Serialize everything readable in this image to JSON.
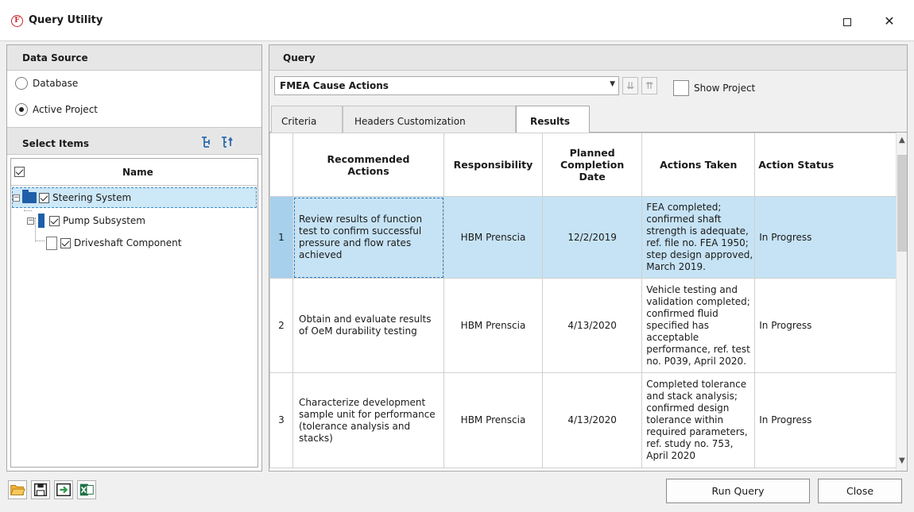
{
  "window": {
    "title": "Query Utility",
    "logo_letter": "F",
    "maximize_icon": "maximize-icon",
    "close_glyph": "✕"
  },
  "data_source": {
    "header": "Data Source",
    "options": [
      {
        "label": "Database",
        "selected": false
      },
      {
        "label": "Active Project",
        "selected": true
      }
    ]
  },
  "select_items": {
    "header": "Select Items",
    "tree_header": "Name",
    "nodes": [
      {
        "label": "Steering System",
        "checked": true,
        "expanded": true,
        "icon": "system-folder-icon"
      },
      {
        "label": "Pump Subsystem",
        "checked": true,
        "expanded": true,
        "icon": "subsystem-icon"
      },
      {
        "label": "Driveshaft Component",
        "checked": true,
        "icon": "component-icon"
      }
    ]
  },
  "query": {
    "header": "Query",
    "selected": "FMEA Cause Actions",
    "show_project_label": "Show Project",
    "show_project_checked": false
  },
  "tabs": [
    "Criteria",
    "Headers Customization",
    "Results"
  ],
  "active_tab": "Results",
  "results": {
    "columns": [
      "",
      "Recommended Actions",
      "Responsibility",
      "Planned Completion Date",
      "Actions Taken",
      "Action Status"
    ],
    "rows": [
      {
        "n": "1",
        "recommended": "Review results of function test to confirm successful pressure and flow rates achieved",
        "responsibility": "HBM Prenscia",
        "date": "12/2/2019",
        "actions_taken": "FEA completed; confirmed shaft strength is adequate, ref. file no. FEA 1950; step design approved, March 2019.",
        "status": "In Progress"
      },
      {
        "n": "2",
        "recommended": "Obtain and evaluate results of OeM durability testing",
        "responsibility": "HBM Prenscia",
        "date": "4/13/2020",
        "actions_taken": "Vehicle testing and validation completed; confirmed fluid specified has acceptable performance, ref. test no. P039, April 2020.",
        "status": "In Progress"
      },
      {
        "n": "3",
        "recommended": "Characterize development sample unit for performance (tolerance analysis and stacks)",
        "responsibility": "HBM Prenscia",
        "date": "4/13/2020",
        "actions_taken": "Completed tolerance and stack analysis; confirmed design tolerance within required parameters, ref. study no. 753, April 2020",
        "status": "In Progress"
      }
    ]
  },
  "bottom": {
    "icons": [
      "open-folder-icon",
      "save-icon",
      "export-icon",
      "excel-icon"
    ],
    "run_query": "Run Query",
    "close": "Close"
  },
  "colors": {
    "selection": "#c6e3f5",
    "folder_blue": "#1f5fa8",
    "logo_red": "#c8242b",
    "excel_green": "#1e7145"
  }
}
